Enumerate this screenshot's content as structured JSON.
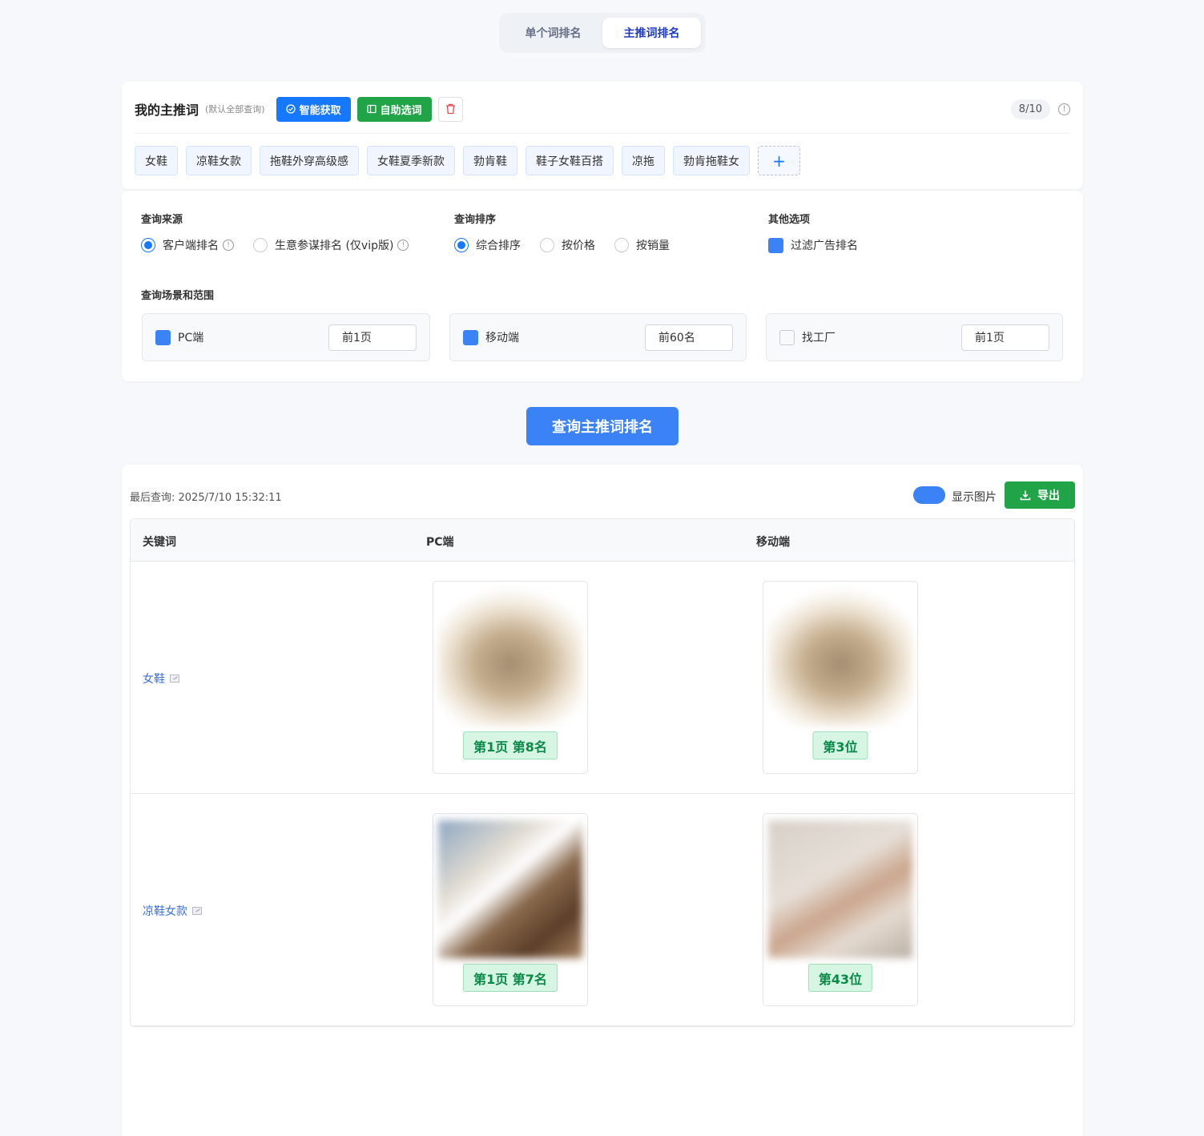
{
  "tabs": [
    {
      "label": "单个词排名",
      "active": false
    },
    {
      "label": "主推词排名",
      "active": true
    }
  ],
  "keywords": {
    "title": "我的主推词",
    "subtitle": "(默认全部查询)",
    "smart_fetch_label": "智能获取",
    "self_select_label": "自助选词",
    "count": "8/10",
    "tags": [
      "女鞋",
      "凉鞋女款",
      "拖鞋外穿高级感",
      "女鞋夏季新款",
      "勃肯鞋",
      "鞋子女鞋百搭",
      "凉拖",
      "勃肯拖鞋女"
    ],
    "add_symbol": "+"
  },
  "options": {
    "source_label": "查询来源",
    "source_options": [
      {
        "label": "客户端排名",
        "selected": true
      },
      {
        "label": "生意参谋排名 (仅vip版)",
        "selected": false
      }
    ],
    "sort_label": "查询排序",
    "sort_options": [
      {
        "label": "综合排序",
        "selected": true
      },
      {
        "label": "按价格",
        "selected": false
      },
      {
        "label": "按销量",
        "selected": false
      }
    ],
    "other_label": "其他选项",
    "other_options": [
      {
        "label": "过滤广告排名",
        "checked": true
      }
    ],
    "scene_label": "查询场景和范围",
    "scenes": [
      {
        "label": "PC端",
        "checked": true,
        "range": "前1页"
      },
      {
        "label": "移动端",
        "checked": true,
        "range": "前60名"
      },
      {
        "label": "找工厂",
        "checked": false,
        "range": "前1页"
      }
    ]
  },
  "query_button": "查询主推词排名",
  "results": {
    "last_query": "最后查询: 2025/7/10 15:32:11",
    "show_images_label": "显示图片",
    "show_images": true,
    "export_label": "导出",
    "columns": [
      "关键词",
      "PC端",
      "移动端"
    ],
    "rows": [
      {
        "keyword": "女鞋",
        "pc_rank": "第1页 第8名",
        "mobile_rank": "第3位"
      },
      {
        "keyword": "凉鞋女款",
        "pc_rank": "第1页 第7名",
        "mobile_rank": "第43位"
      }
    ]
  },
  "colors": {
    "primary": "#3b82f6",
    "brand_blue": "#1677ff",
    "success": "#21a348",
    "rank_bg": "#d6f5e3",
    "rank_text": "#0a8a48",
    "page_bg": "#f6f8fc"
  }
}
